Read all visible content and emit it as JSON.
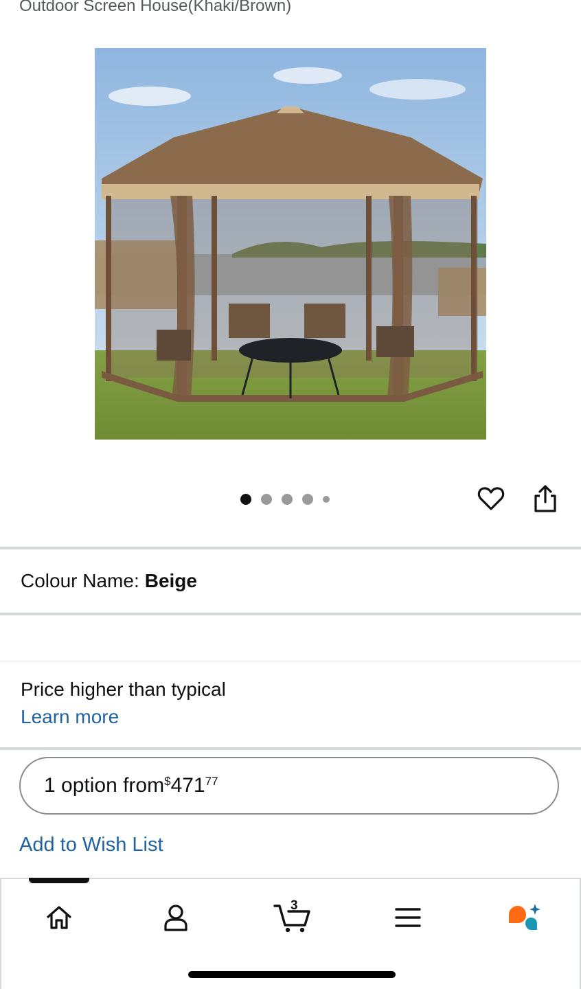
{
  "product": {
    "title": "Outdoor Screen House(Khaki/Brown)",
    "image_dots": {
      "count": 5,
      "active_index": 0
    }
  },
  "actions": {
    "favorite_icon": "heart-icon",
    "share_icon": "share-icon"
  },
  "colour": {
    "label": "Colour Name:",
    "value": "Beige"
  },
  "pricing": {
    "note": "Price higher than typical",
    "learn_more": "Learn more",
    "option_prefix": "1 option from ",
    "currency": "$",
    "dollars": "471",
    "cents": "77"
  },
  "wishlist": {
    "label": "Add to Wish List"
  },
  "bottom_nav": {
    "items": [
      {
        "name": "home",
        "icon": "home-icon"
      },
      {
        "name": "account",
        "icon": "person-icon"
      },
      {
        "name": "cart",
        "icon": "cart-icon",
        "badge": "3"
      },
      {
        "name": "menu",
        "icon": "menu-icon"
      },
      {
        "name": "rufus",
        "icon": "assistant-icon"
      }
    ]
  },
  "colors": {
    "link": "#2162a1",
    "text": "#0f1111",
    "divider": "#d5d9d9",
    "assistant_orange": "#ff6a12",
    "assistant_teal": "#1a98b3"
  }
}
